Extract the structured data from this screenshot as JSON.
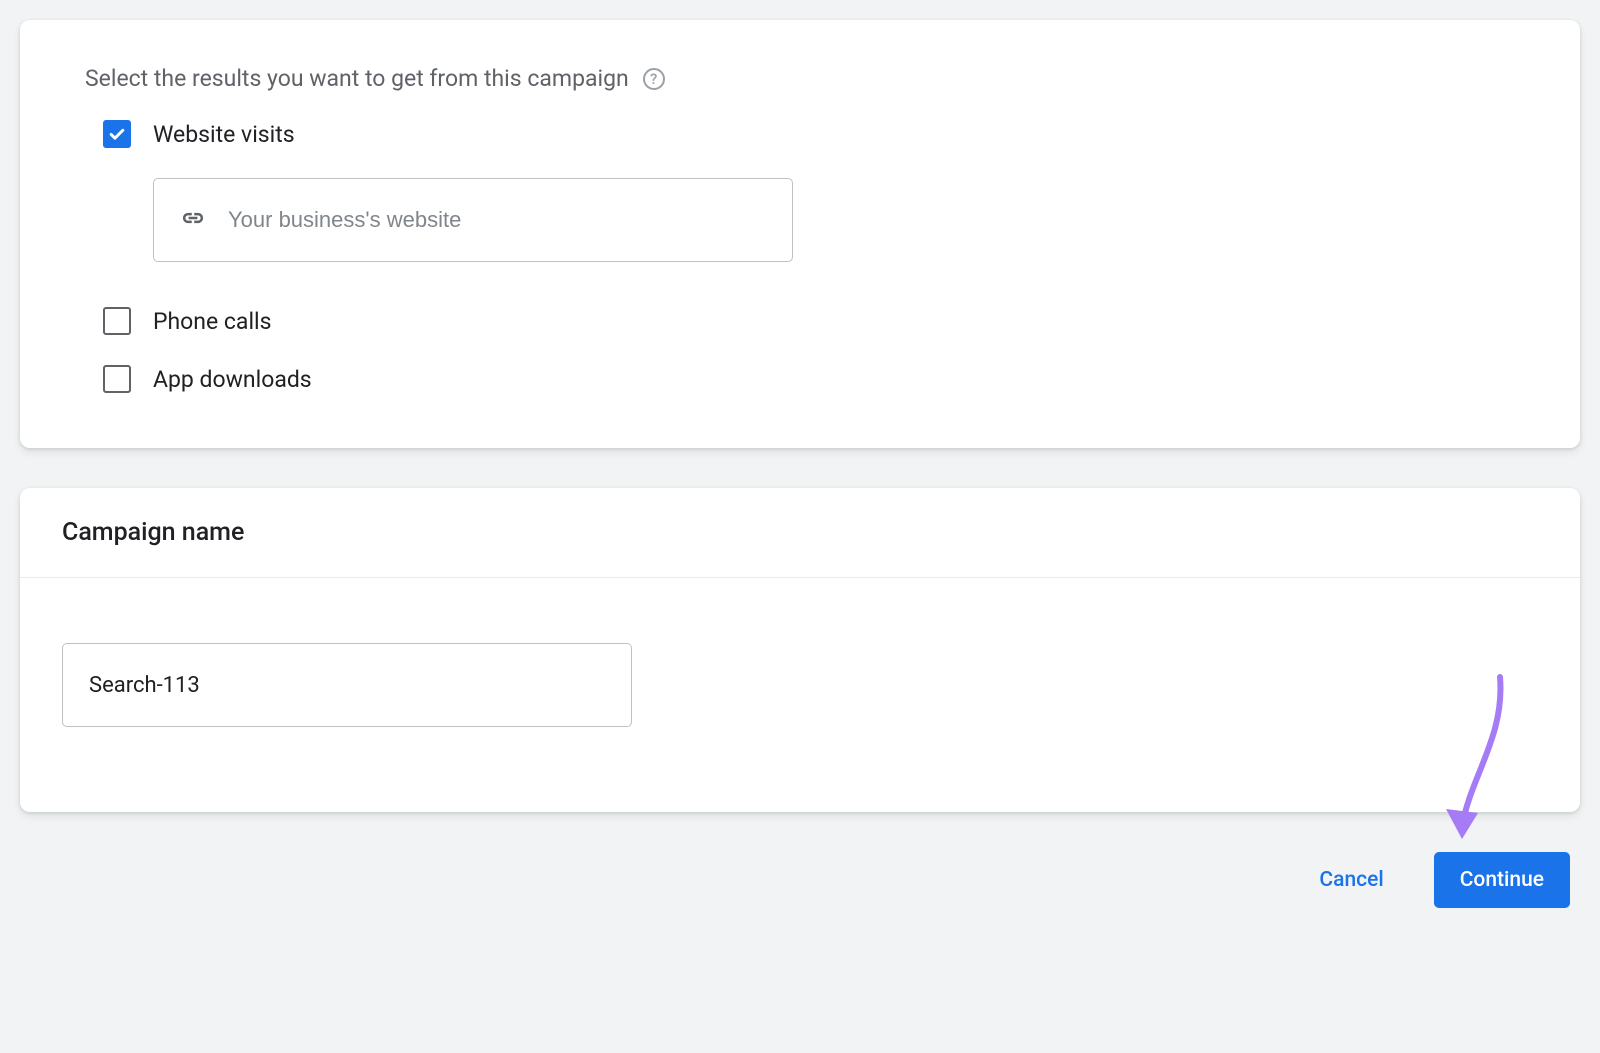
{
  "results_card": {
    "instruction": "Select the results you want to get from this campaign",
    "options": [
      {
        "label": "Website visits",
        "checked": true
      },
      {
        "label": "Phone calls",
        "checked": false
      },
      {
        "label": "App downloads",
        "checked": false
      }
    ],
    "website_placeholder": "Your business's website",
    "website_value": ""
  },
  "name_card": {
    "title": "Campaign name",
    "value": "Search-113"
  },
  "actions": {
    "cancel": "Cancel",
    "continue": "Continue"
  },
  "colors": {
    "accent": "#1a73e8",
    "annotation": "#a57cf5"
  }
}
